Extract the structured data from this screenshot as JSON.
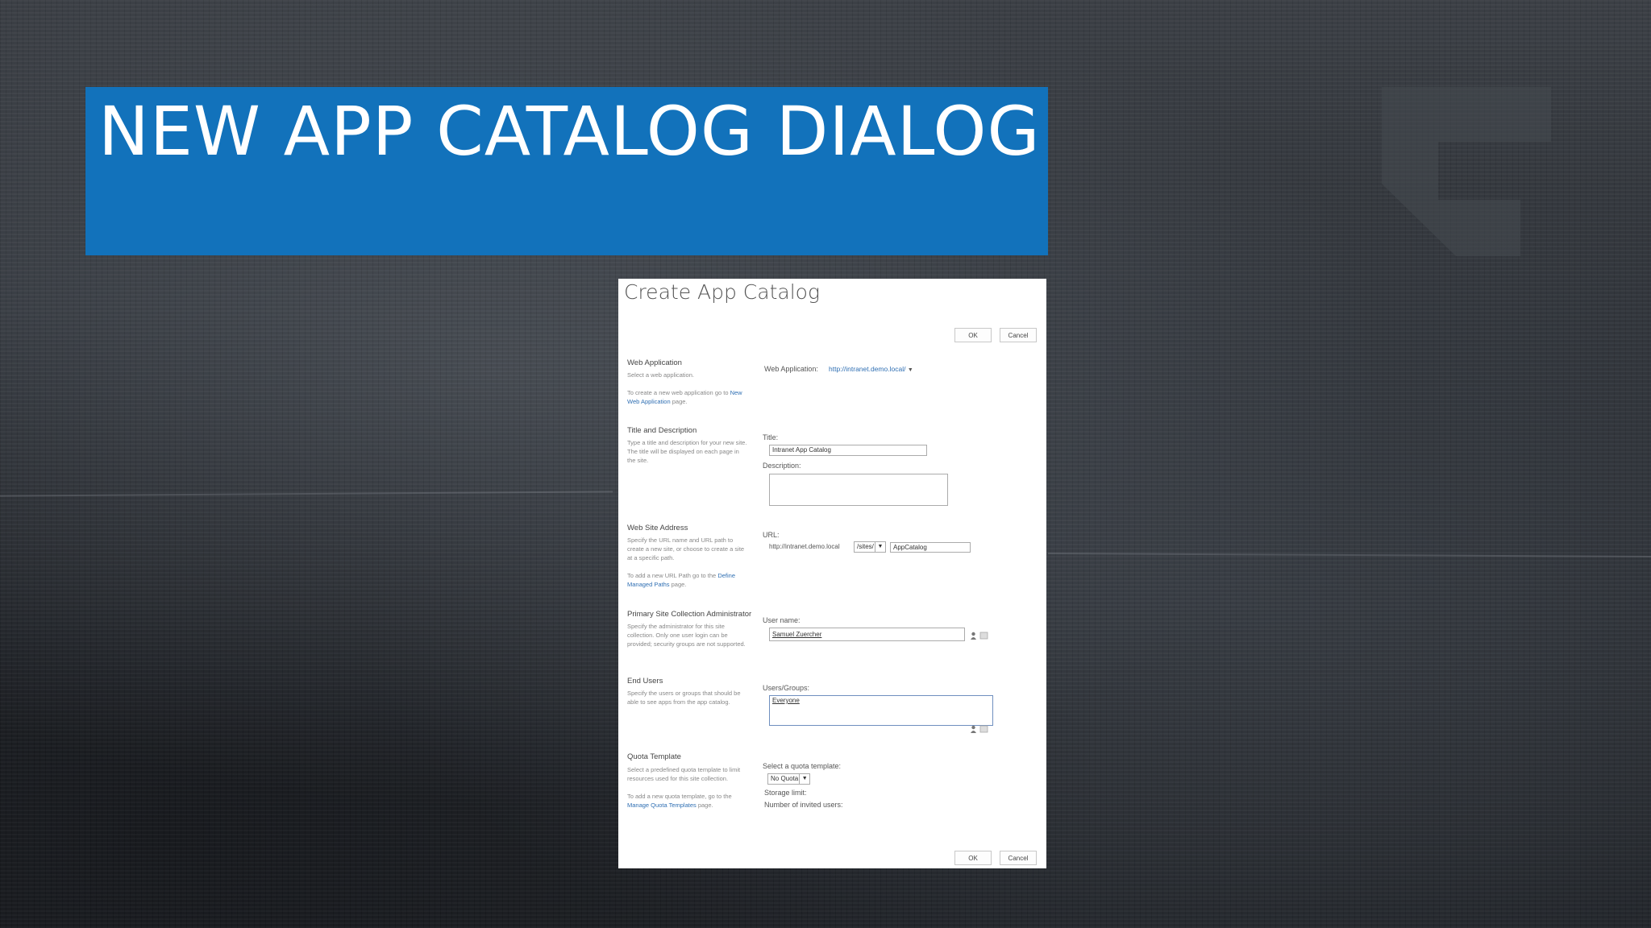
{
  "slide": {
    "title": "NEW APP CATALOG DIALOG",
    "accent_color": "#1272bb"
  },
  "dialog": {
    "title": "Create App Catalog",
    "ok_label": "OK",
    "cancel_label": "Cancel",
    "sections": {
      "web_app": {
        "title": "Web Application",
        "desc": "Select a web application.",
        "desc2_prefix": "To create a new web application go to",
        "desc2_link": "New Web Application",
        "desc2_suffix": "page.",
        "field_label": "Web Application:",
        "value": "http://intranet.demo.local/"
      },
      "title_desc": {
        "title": "Title and Description",
        "desc": "Type a title and description for your new site. The title will be displayed on each page in the site.",
        "title_label": "Title:",
        "title_value": "Intranet App Catalog",
        "description_label": "Description:",
        "description_value": ""
      },
      "address": {
        "title": "Web Site Address",
        "desc": "Specify the URL name and URL path to create a new site, or choose to create a site at a specific path.",
        "desc2_prefix": "To add a new URL Path go to the",
        "desc2_link": "Define Managed Paths",
        "desc2_suffix": "page.",
        "url_label": "URL:",
        "url_prefix": "http://intranet.demo.local",
        "path_selected": "/sites/",
        "url_name": "AppCatalog"
      },
      "admin": {
        "title": "Primary Site Collection Administrator",
        "desc": "Specify the administrator for this site collection. Only one user login can be provided; security groups are not supported.",
        "user_label": "User name:",
        "user_value": "Samuel Zuercher"
      },
      "end_users": {
        "title": "End Users",
        "desc": "Specify the users or groups that should be able to see apps from the app catalog.",
        "label": "Users/Groups:",
        "value": "Everyone"
      },
      "quota": {
        "title": "Quota Template",
        "desc": "Select a predefined quota template to limit resources used for this site collection.",
        "desc2_prefix": "To add a new quota template, go to the",
        "desc2_link": "Manage Quota Templates",
        "desc2_suffix": "page.",
        "select_label": "Select a quota template:",
        "select_value": "No Quota",
        "storage_label": "Storage limit:",
        "invited_label": "Number of invited users:"
      }
    }
  }
}
